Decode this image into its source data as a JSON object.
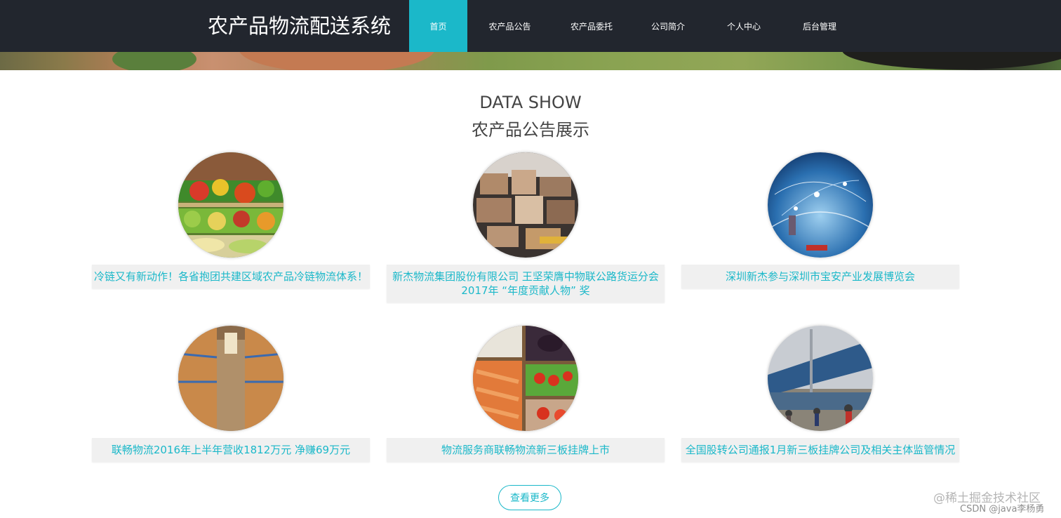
{
  "header": {
    "title": "农产品物流配送系统",
    "nav": [
      {
        "label": "首页",
        "active": true
      },
      {
        "label": "农产品公告",
        "active": false
      },
      {
        "label": "农产品委托",
        "active": false
      },
      {
        "label": "公司简介",
        "active": false
      },
      {
        "label": "个人中心",
        "active": false
      },
      {
        "label": "后台管理",
        "active": false
      }
    ]
  },
  "section": {
    "title_en": "DATA SHOW",
    "title_cn": "农产品公告展示"
  },
  "announcements": [
    {
      "title": "冷链又有新动作！各省抱团共建区域农产品冷链物流体系！",
      "image": "vegetable-shelf-image"
    },
    {
      "title": "新杰物流集团股份有限公司 王坚荣膺中物联公路货运分会2017年 “年度贡献人物” 奖",
      "image": "warehouse-boxes-image"
    },
    {
      "title": "深圳新杰参与深圳市宝安产业发展博览会",
      "image": "global-network-image"
    },
    {
      "title": "联畅物流2016年上半年营收1812万元 净赚69万元",
      "image": "warehouse-racks-image"
    },
    {
      "title": "物流服务商联畅物流新三板挂牌上市",
      "image": "produce-crates-image"
    },
    {
      "title": "全国股转公司通报1月新三板挂牌公司及相关主体监管情况",
      "image": "logistics-yard-image"
    }
  ],
  "more_button": "查看更多",
  "watermark": {
    "line1": "@稀土掘金技术社区",
    "line2": "CSDN @java李杨勇"
  },
  "colors": {
    "accent": "#1bb8c9",
    "header_bg": "#22262e",
    "caption_bg": "#f0f0f0"
  }
}
